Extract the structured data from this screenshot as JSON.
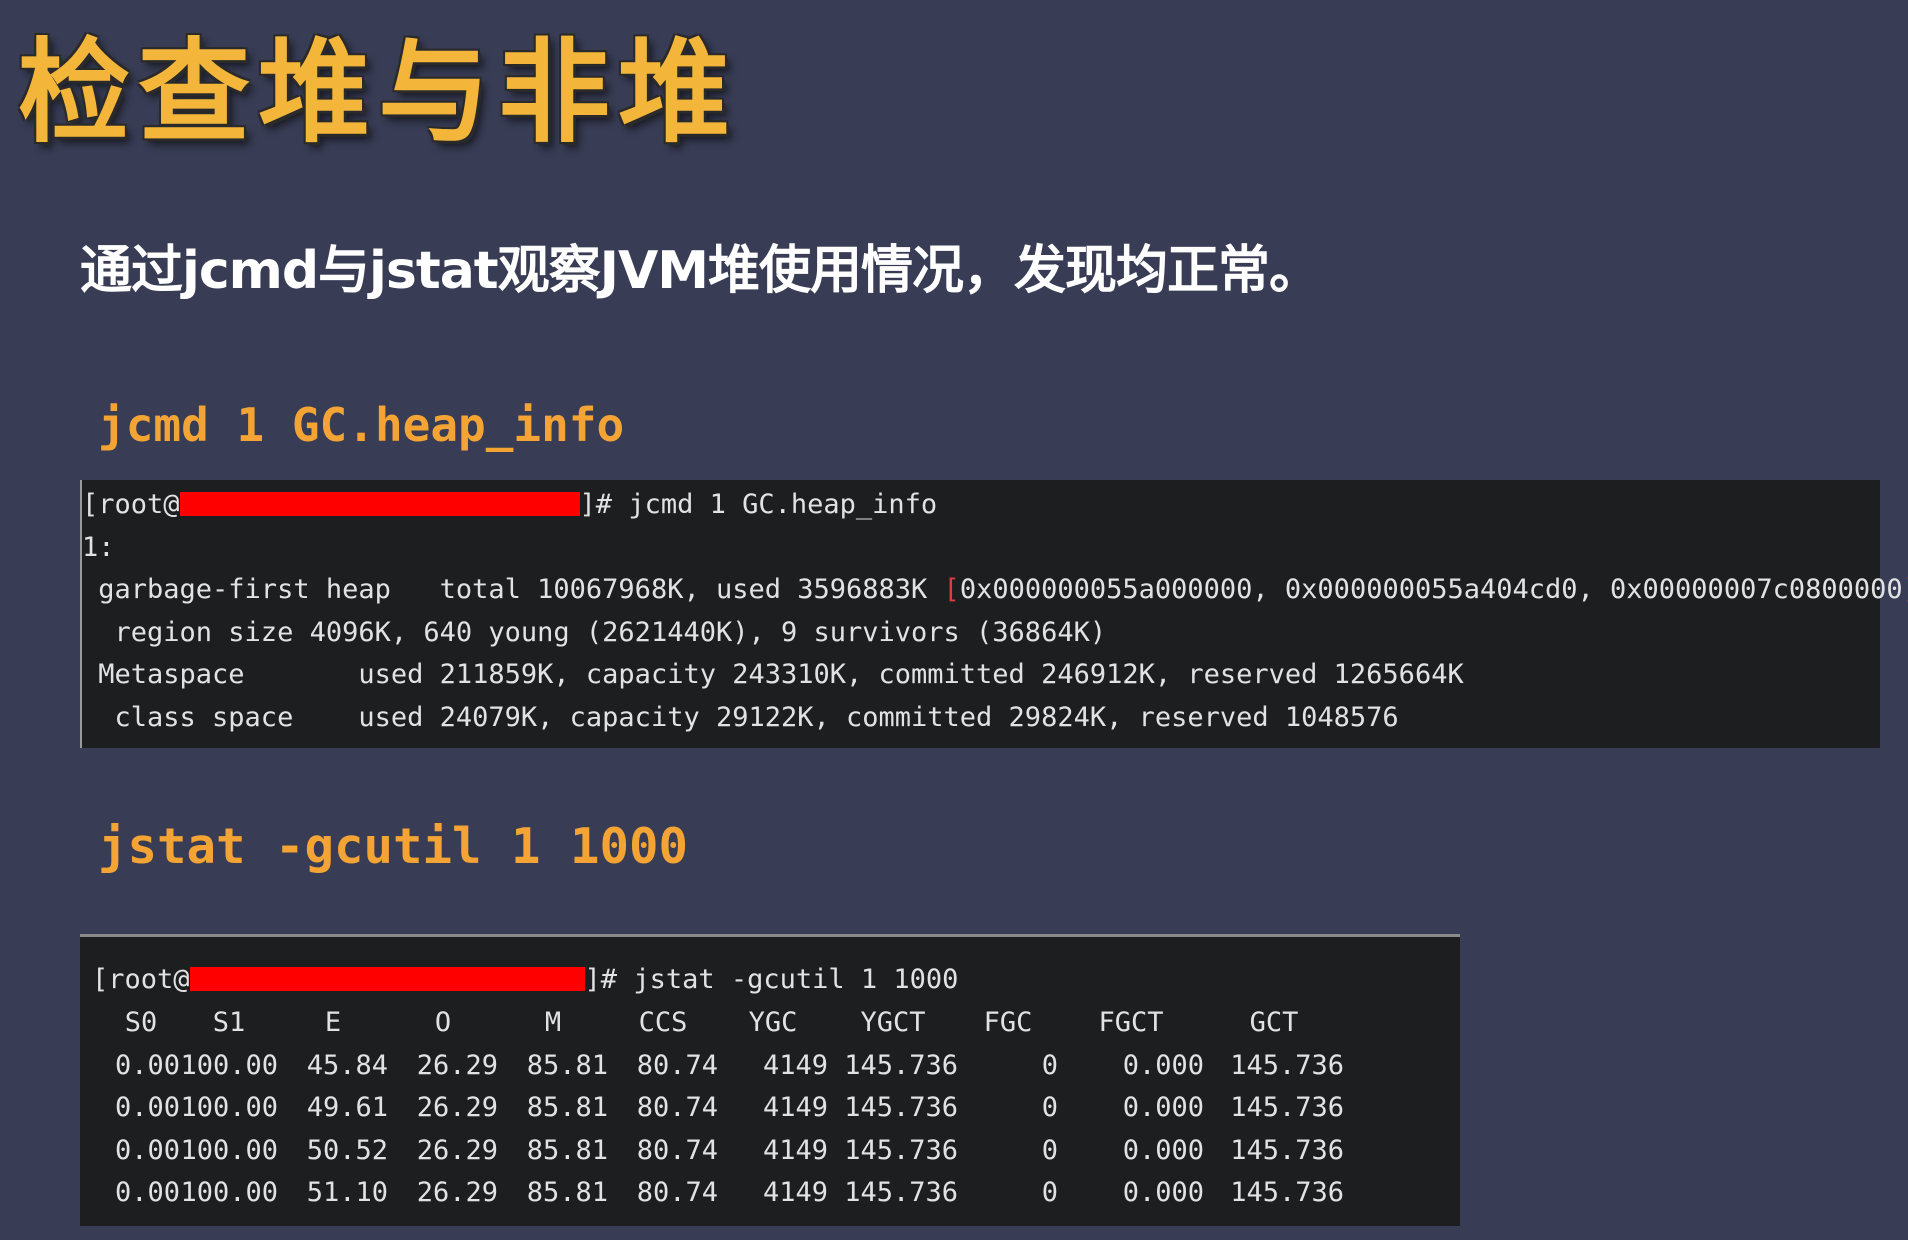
{
  "slide": {
    "title": "检查堆与非堆",
    "subtitle": "通过jcmd与jstat观察JVM堆使用情况，发现均正常。"
  },
  "section1": {
    "heading": "jcmd 1 GC.heap_info",
    "prompt_prefix": "[root@",
    "prompt_suffix": "]# jcmd 1 GC.heap_info",
    "lines": {
      "pid": "1:",
      "heap_a": " garbage-first heap   total 10067968K, used 3596883K ",
      "heap_bracket_open": "[",
      "heap_b": "0x000000055a000000, 0x000000055a404cd0, 0x00000007c0800000",
      "heap_bracket_close": ")",
      "region": "  region size 4096K, 640 young (2621440K), 9 survivors (36864K)",
      "metaspace": " Metaspace       used 211859K, capacity 243310K, committed 246912K, reserved 1265664K",
      "class_space": "  class space    used 24079K, capacity 29122K, committed 29824K, reserved 1048576"
    }
  },
  "section2": {
    "heading": "jstat -gcutil 1 1000",
    "prompt_prefix": "[root@",
    "prompt_suffix": "]# jstat -gcutil 1 1000",
    "headers": [
      "S0",
      "S1",
      "E",
      "O",
      "M",
      "CCS",
      "YGC",
      "YGCT",
      "FGC",
      "FGCT",
      "GCT"
    ],
    "rows": [
      [
        "0.00",
        "100.00",
        "45.84",
        "26.29",
        "85.81",
        "80.74",
        "4149",
        "145.736",
        "0",
        "0.000",
        "145.736"
      ],
      [
        "0.00",
        "100.00",
        "49.61",
        "26.29",
        "85.81",
        "80.74",
        "4149",
        "145.736",
        "0",
        "0.000",
        "145.736"
      ],
      [
        "0.00",
        "100.00",
        "50.52",
        "26.29",
        "85.81",
        "80.74",
        "4149",
        "145.736",
        "0",
        "0.000",
        "145.736"
      ],
      [
        "0.00",
        "100.00",
        "51.10",
        "26.29",
        "85.81",
        "80.74",
        "4149",
        "145.736",
        "0",
        "0.000",
        "145.736"
      ]
    ]
  },
  "colors": {
    "background": "#383c54",
    "title": "#f4b63a",
    "heading": "#f4a435",
    "terminal_bg": "#1d1e20",
    "redaction": "#ff0000"
  }
}
